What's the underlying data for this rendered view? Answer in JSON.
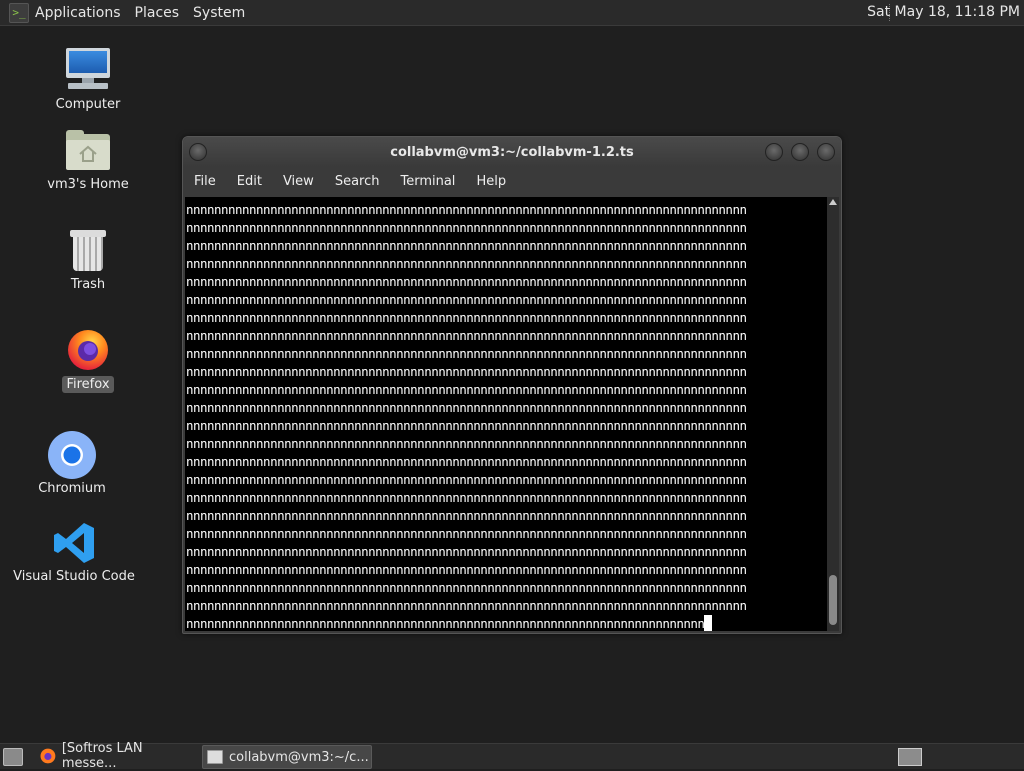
{
  "top_panel": {
    "menus": [
      "Applications",
      "Places",
      "System"
    ],
    "clock": "Sat May 18, 11:18 PM"
  },
  "desktop": {
    "icons": [
      {
        "label": "Computer",
        "icon": "computer-icon"
      },
      {
        "label": "vm3's Home",
        "icon": "home-folder-icon"
      },
      {
        "label": "Trash",
        "icon": "trash-icon"
      },
      {
        "label": "Firefox",
        "icon": "firefox-icon",
        "selected": true
      },
      {
        "label": "Chromium",
        "icon": "chromium-icon"
      },
      {
        "label": "Visual Studio Code",
        "icon": "vscode-icon"
      }
    ]
  },
  "terminal": {
    "title": "collabvm@vm3:~/collabvm-1.2.ts",
    "menus": [
      "File",
      "Edit",
      "View",
      "Search",
      "Terminal",
      "Help"
    ],
    "line_text": "nnnnnnnnnnnnnnnnnnnnnnnnnnnnnnnnnnnnnnnnnnnnnnnnnnnnnnnnnnnnnnnnnnnnnnnnnnnnnnnn",
    "last_line_text": "nnnnnnnnnnnnnnnnnnnnnnnnnnnnnnnnnnnnnnnnnnnnnnnnnnnnnnnnnnnnnnnnnnnnnnnnnn",
    "line_count": 24,
    "colors": {
      "background": "#000000",
      "foreground": "#ffffff"
    }
  },
  "taskbar": {
    "tasks": [
      {
        "label": "[Softros LAN messe...",
        "icon": "firefox-icon",
        "active": false
      },
      {
        "label": "collabvm@vm3:~/c...",
        "icon": "terminal-icon",
        "active": true
      }
    ]
  }
}
